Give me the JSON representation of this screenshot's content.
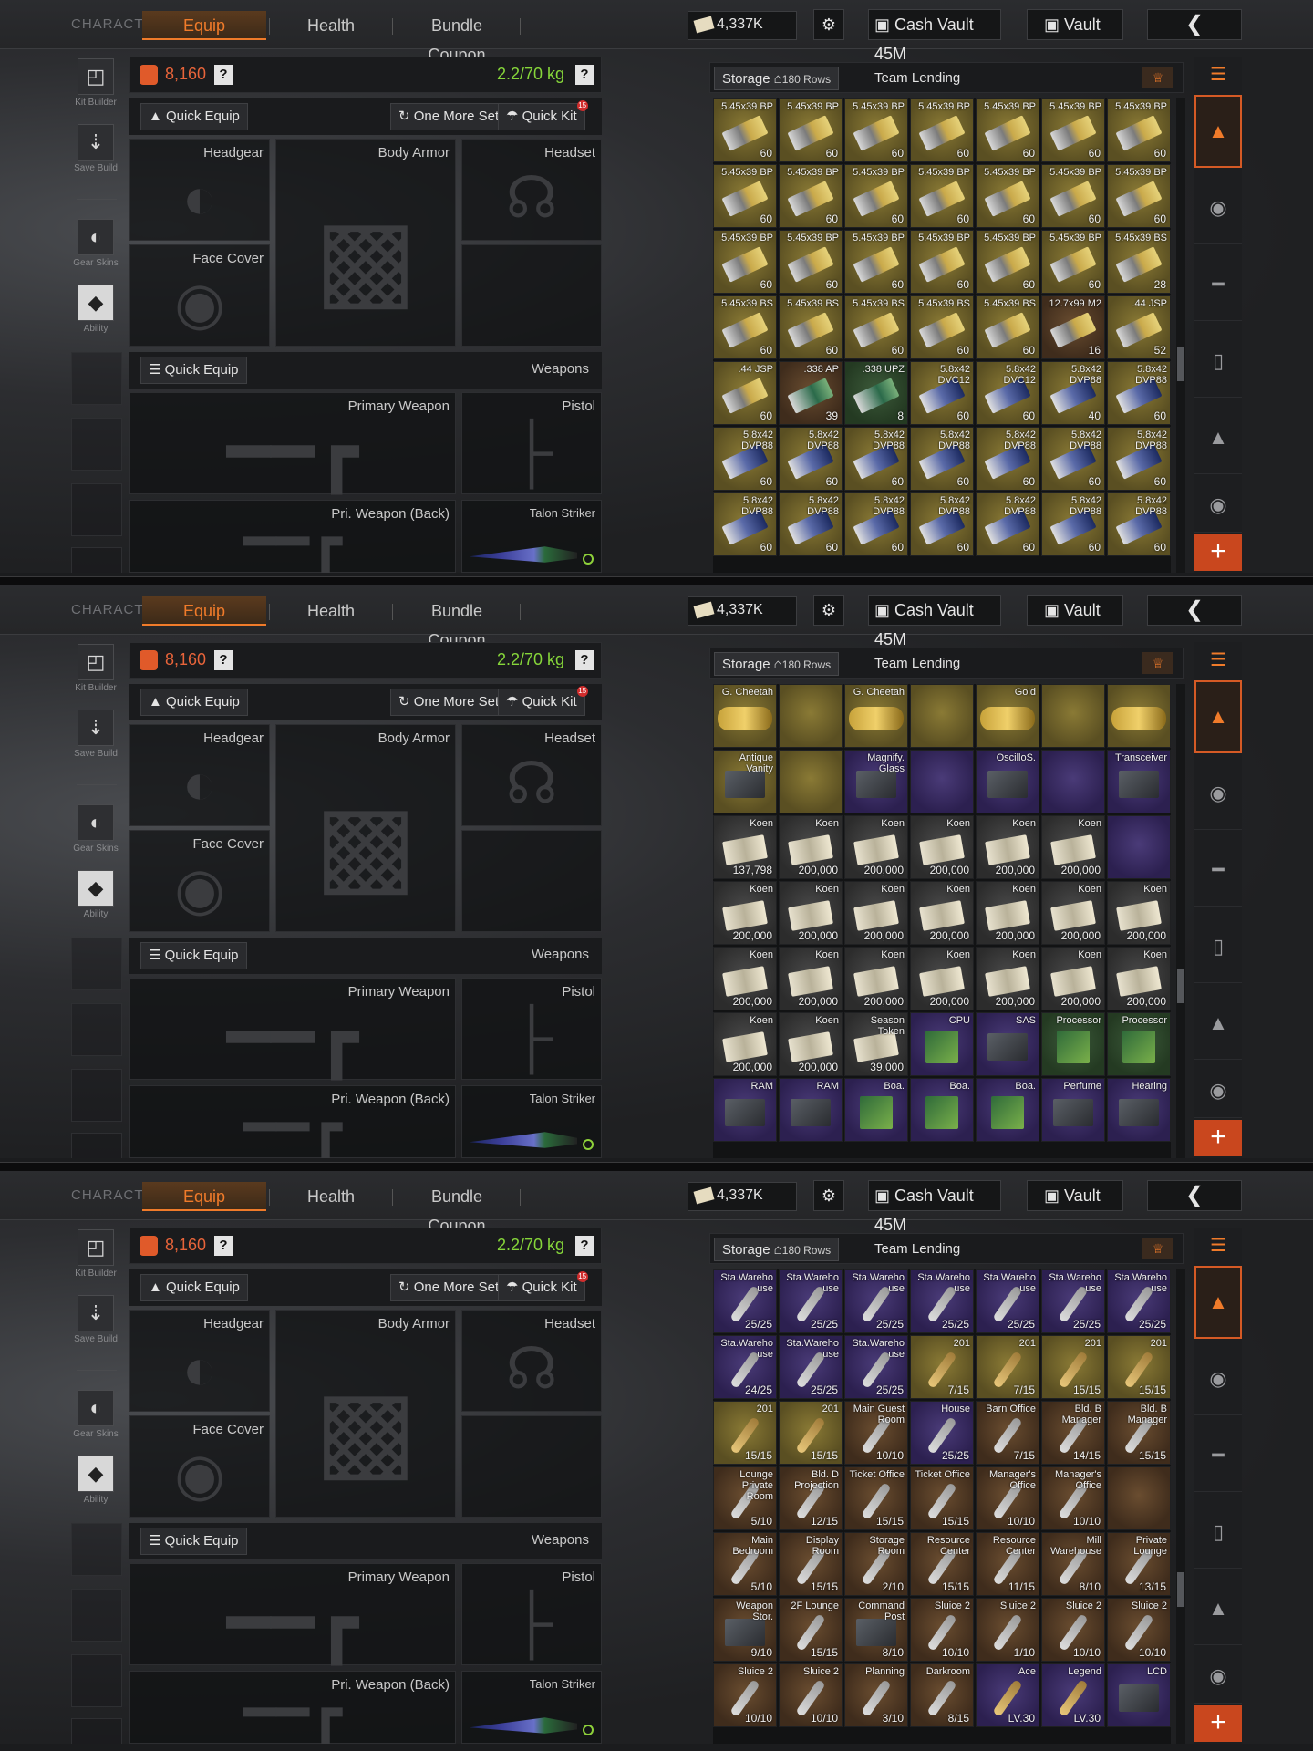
{
  "topbar": {
    "character_label": "CHARACTER",
    "tabs": [
      "Equip",
      "Health",
      "Bundle Coupon"
    ],
    "money": "4,337K",
    "cash_vault": "Cash Vault 45M",
    "vault": "Vault",
    "back_icon": "chevron-left-icon"
  },
  "rail": {
    "kit_builder": "Kit Builder",
    "save_build": "Save Build",
    "gear_skins": "Gear Skins",
    "ability": "Ability"
  },
  "equip": {
    "value": "8,160",
    "weight": "2.2/70 kg",
    "quick_equip": "Quick Equip",
    "one_more_set": "One More Set",
    "quick_kit": "Quick Kit",
    "quick_kit_badge": "15",
    "weapons_label": "Weapons",
    "slots": {
      "headgear": "Headgear",
      "body_armor": "Body Armor",
      "headset": "Headset",
      "face_cover": "Face Cover",
      "primary_weapon": "Primary Weapon",
      "pistol": "Pistol",
      "pri_weapon_back": "Pri. Weapon (Back)",
      "talon_striker": "Talon Striker"
    }
  },
  "storage": {
    "tab_storage": "Storage",
    "rows": "180 Rows",
    "tab_team_lending": "Team Lending"
  },
  "colors": {
    "accent": "#f07b2a",
    "weight_green": "#86d63a",
    "gold_cell": "#6d6230",
    "purple_cell": "#3a2d63",
    "brown_cell": "#533b26"
  },
  "panels": [
    {
      "rows": [
        [
          [
            "5.45x39 BP",
            "60",
            "gold",
            "ammo"
          ],
          [
            "5.45x39 BP",
            "60",
            "gold",
            "ammo"
          ],
          [
            "5.45x39 BP",
            "60",
            "gold",
            "ammo"
          ],
          [
            "5.45x39 BP",
            "60",
            "gold",
            "ammo"
          ],
          [
            "5.45x39 BP",
            "60",
            "gold",
            "ammo"
          ],
          [
            "5.45x39 BP",
            "60",
            "gold",
            "ammo"
          ],
          [
            "5.45x39 BP",
            "60",
            "gold",
            "ammo"
          ]
        ],
        [
          [
            "5.45x39 BP",
            "60",
            "gold",
            "ammo"
          ],
          [
            "5.45x39 BP",
            "60",
            "gold",
            "ammo"
          ],
          [
            "5.45x39 BP",
            "60",
            "gold",
            "ammo"
          ],
          [
            "5.45x39 BP",
            "60",
            "gold",
            "ammo"
          ],
          [
            "5.45x39 BP",
            "60",
            "gold",
            "ammo"
          ],
          [
            "5.45x39 BP",
            "60",
            "gold",
            "ammo"
          ],
          [
            "5.45x39 BP",
            "60",
            "gold",
            "ammo"
          ]
        ],
        [
          [
            "5.45x39 BP",
            "60",
            "gold",
            "ammo"
          ],
          [
            "5.45x39 BP",
            "60",
            "gold",
            "ammo"
          ],
          [
            "5.45x39 BP",
            "60",
            "gold",
            "ammo"
          ],
          [
            "5.45x39 BP",
            "60",
            "gold",
            "ammo"
          ],
          [
            "5.45x39 BP",
            "60",
            "gold",
            "ammo"
          ],
          [
            "5.45x39 BP",
            "60",
            "gold",
            "ammo"
          ],
          [
            "5.45x39 BS",
            "28",
            "gold",
            "ammo"
          ]
        ],
        [
          [
            "5.45x39 BS",
            "60",
            "gold",
            "ammo"
          ],
          [
            "5.45x39 BS",
            "60",
            "gold",
            "ammo"
          ],
          [
            "5.45x39 BS",
            "60",
            "gold",
            "ammo"
          ],
          [
            "5.45x39 BS",
            "60",
            "gold",
            "ammo"
          ],
          [
            "5.45x39 BS",
            "60",
            "gold",
            "ammo"
          ],
          [
            "12.7x99 M2",
            "16",
            "brown",
            "ammo"
          ],
          [
            ".44 JSP",
            "52",
            "gold",
            "ammo"
          ]
        ],
        [
          [
            ".44 JSP",
            "60",
            "gold",
            "ammo"
          ],
          [
            ".338 AP",
            "39",
            "brown",
            "ammogreen"
          ],
          [
            ".338 UPZ",
            "8",
            "green",
            "ammogreen"
          ],
          [
            "5.8x42 DVC12",
            "60",
            "gold",
            "ammoblue"
          ],
          [
            "5.8x42 DVC12",
            "60",
            "gold",
            "ammoblue"
          ],
          [
            "5.8x42 DVP88",
            "40",
            "gold",
            "ammoblue"
          ],
          [
            "5.8x42 DVP88",
            "60",
            "gold",
            "ammoblue"
          ]
        ],
        [
          [
            "5.8x42 DVP88",
            "60",
            "gold",
            "ammoblue"
          ],
          [
            "5.8x42 DVP88",
            "60",
            "gold",
            "ammoblue"
          ],
          [
            "5.8x42 DVP88",
            "60",
            "gold",
            "ammoblue"
          ],
          [
            "5.8x42 DVP88",
            "60",
            "gold",
            "ammoblue"
          ],
          [
            "5.8x42 DVP88",
            "60",
            "gold",
            "ammoblue"
          ],
          [
            "5.8x42 DVP88",
            "60",
            "gold",
            "ammoblue"
          ],
          [
            "5.8x42 DVP88",
            "60",
            "gold",
            "ammoblue"
          ]
        ],
        [
          [
            "5.8x42 DVP88",
            "60",
            "gold",
            "ammoblue"
          ],
          [
            "5.8x42 DVP88",
            "60",
            "gold",
            "ammoblue"
          ],
          [
            "5.8x42 DVP88",
            "60",
            "gold",
            "ammoblue"
          ],
          [
            "5.8x42 DVP88",
            "60",
            "gold",
            "ammoblue"
          ],
          [
            "5.8x42 DVP88",
            "60",
            "gold",
            "ammoblue"
          ],
          [
            "5.8x42 DVP88",
            "60",
            "gold",
            "ammoblue"
          ],
          [
            "5.8x42 DVP88",
            "60",
            "gold",
            "ammoblue"
          ]
        ]
      ]
    },
    {
      "rows": [
        [
          [
            "G. Cheetah",
            "",
            "gold",
            "statue"
          ],
          [
            "",
            "",
            "gold",
            ""
          ],
          [
            "G. Cheetah",
            "",
            "gold",
            "statue"
          ],
          [
            "",
            "",
            "gold",
            ""
          ],
          [
            "Gold",
            "",
            "gold",
            "statue"
          ],
          [
            "",
            "",
            "gold",
            ""
          ],
          [
            "",
            "",
            "gold",
            "statue"
          ]
        ],
        [
          [
            "Antique Vanity",
            "",
            "gold",
            "device"
          ],
          [
            "",
            "",
            "gold",
            ""
          ],
          [
            "Magnify. Glass",
            "",
            "purple",
            "device"
          ],
          [
            "",
            "",
            "purple",
            ""
          ],
          [
            "OscilloS.",
            "",
            "purple",
            "device"
          ],
          [
            "",
            "",
            "purple",
            ""
          ],
          [
            "Transceiver",
            "",
            "purple",
            "device"
          ]
        ],
        [
          [
            "Koen",
            "137,798",
            "gray",
            "money"
          ],
          [
            "Koen",
            "200,000",
            "gray",
            "money"
          ],
          [
            "Koen",
            "200,000",
            "gray",
            "money"
          ],
          [
            "Koen",
            "200,000",
            "gray",
            "money"
          ],
          [
            "Koen",
            "200,000",
            "gray",
            "money"
          ],
          [
            "Koen",
            "200,000",
            "gray",
            "money"
          ],
          [
            "",
            "",
            "purple",
            ""
          ]
        ],
        [
          [
            "Koen",
            "200,000",
            "gray",
            "money"
          ],
          [
            "Koen",
            "200,000",
            "gray",
            "money"
          ],
          [
            "Koen",
            "200,000",
            "gray",
            "money"
          ],
          [
            "Koen",
            "200,000",
            "gray",
            "money"
          ],
          [
            "Koen",
            "200,000",
            "gray",
            "money"
          ],
          [
            "Koen",
            "200,000",
            "gray",
            "money"
          ],
          [
            "Koen",
            "200,000",
            "gray",
            "money"
          ]
        ],
        [
          [
            "Koen",
            "200,000",
            "gray",
            "money"
          ],
          [
            "Koen",
            "200,000",
            "gray",
            "money"
          ],
          [
            "Koen",
            "200,000",
            "gray",
            "money"
          ],
          [
            "Koen",
            "200,000",
            "gray",
            "money"
          ],
          [
            "Koen",
            "200,000",
            "gray",
            "money"
          ],
          [
            "Koen",
            "200,000",
            "gray",
            "money"
          ],
          [
            "Koen",
            "200,000",
            "gray",
            "money"
          ]
        ],
        [
          [
            "Koen",
            "200,000",
            "gray",
            "money"
          ],
          [
            "Koen",
            "200,000",
            "gray",
            "money"
          ],
          [
            "Season Token",
            "39,000",
            "gray",
            "money"
          ],
          [
            "CPU",
            "",
            "purple",
            "chip"
          ],
          [
            "SAS",
            "",
            "purple",
            "device"
          ],
          [
            "Processor",
            "",
            "green",
            "chip"
          ],
          [
            "Processor",
            "",
            "green",
            "chip"
          ]
        ],
        [
          [
            "RAM",
            "",
            "purple",
            "device"
          ],
          [
            "RAM",
            "",
            "purple",
            "device"
          ],
          [
            "Boa.",
            "",
            "purple",
            "chip"
          ],
          [
            "Boa.",
            "",
            "purple",
            "chip"
          ],
          [
            "Boa.",
            "",
            "purple",
            "chip"
          ],
          [
            "Perfume",
            "",
            "purple",
            "device"
          ],
          [
            "Hearing",
            "",
            "purple",
            "device"
          ]
        ]
      ]
    },
    {
      "rows": [
        [
          [
            "Sta.Wareho use",
            "25/25",
            "purple",
            "key"
          ],
          [
            "Sta.Wareho use",
            "25/25",
            "purple",
            "key"
          ],
          [
            "Sta.Wareho use",
            "25/25",
            "purple",
            "key"
          ],
          [
            "Sta.Wareho use",
            "25/25",
            "purple",
            "key"
          ],
          [
            "Sta.Wareho use",
            "25/25",
            "purple",
            "key"
          ],
          [
            "Sta.Wareho use",
            "25/25",
            "purple",
            "key"
          ],
          [
            "Sta.Wareho use",
            "25/25",
            "purple",
            "key"
          ]
        ],
        [
          [
            "Sta.Wareho use",
            "24/25",
            "purple",
            "key"
          ],
          [
            "Sta.Wareho use",
            "25/25",
            "purple",
            "key"
          ],
          [
            "Sta.Wareho use",
            "25/25",
            "purple",
            "key"
          ],
          [
            "201",
            "7/15",
            "gold",
            "keygold"
          ],
          [
            "201",
            "7/15",
            "gold",
            "keygold"
          ],
          [
            "201",
            "15/15",
            "gold",
            "keygold"
          ],
          [
            "201",
            "15/15",
            "gold",
            "keygold"
          ]
        ],
        [
          [
            "201",
            "15/15",
            "gold",
            "keygold"
          ],
          [
            "201",
            "15/15",
            "gold",
            "keygold"
          ],
          [
            "Main Guest Room",
            "10/10",
            "brown",
            "key"
          ],
          [
            "House",
            "25/25",
            "purple",
            "key"
          ],
          [
            "Barn Office",
            "7/15",
            "brown",
            "key"
          ],
          [
            "Bld. B Manager",
            "14/15",
            "brown",
            "key"
          ],
          [
            "Bld. B Manager",
            "15/15",
            "brown",
            "key"
          ]
        ],
        [
          [
            "Lounge Private Room",
            "5/10",
            "brown",
            "key"
          ],
          [
            "Bld. D Projection",
            "12/15",
            "brown",
            "key"
          ],
          [
            "Ticket Office",
            "15/15",
            "brown",
            "key"
          ],
          [
            "Ticket Office",
            "15/15",
            "brown",
            "key"
          ],
          [
            "Manager's Office",
            "10/10",
            "brown",
            "key"
          ],
          [
            "Manager's Office",
            "10/10",
            "brown",
            "key"
          ],
          [
            "",
            "",
            "brown",
            ""
          ]
        ],
        [
          [
            "Main Bedroom",
            "5/10",
            "brown",
            "key"
          ],
          [
            "Display Room",
            "15/15",
            "brown",
            "key"
          ],
          [
            "Storage Room",
            "2/10",
            "brown",
            "key"
          ],
          [
            "Resource Center",
            "15/15",
            "brown",
            "key"
          ],
          [
            "Resource Center",
            "11/15",
            "brown",
            "key"
          ],
          [
            "Mill Warehouse",
            "8/10",
            "brown",
            "key"
          ],
          [
            "Private Lounge",
            "13/15",
            "brown",
            "key"
          ]
        ],
        [
          [
            "Weapon Stor.",
            "9/10",
            "brown",
            "device"
          ],
          [
            "2F Lounge",
            "15/15",
            "brown",
            "key"
          ],
          [
            "Command Post",
            "8/10",
            "brown",
            "device"
          ],
          [
            "Sluice 2",
            "10/10",
            "brown",
            "key"
          ],
          [
            "Sluice 2",
            "1/10",
            "brown",
            "key"
          ],
          [
            "Sluice 2",
            "10/10",
            "brown",
            "key"
          ],
          [
            "Sluice 2",
            "10/10",
            "brown",
            "key"
          ]
        ],
        [
          [
            "Sluice 2",
            "10/10",
            "brown",
            "key"
          ],
          [
            "Sluice 2",
            "10/10",
            "brown",
            "key"
          ],
          [
            "Planning",
            "3/10",
            "brown",
            "key"
          ],
          [
            "Darkroom",
            "8/15",
            "brown",
            "key"
          ],
          [
            "Ace",
            "LV.30",
            "purple",
            "keygold"
          ],
          [
            "Legend",
            "LV.30",
            "purple",
            "keygold"
          ],
          [
            "LCD",
            "",
            "purple",
            "device"
          ]
        ]
      ]
    }
  ]
}
